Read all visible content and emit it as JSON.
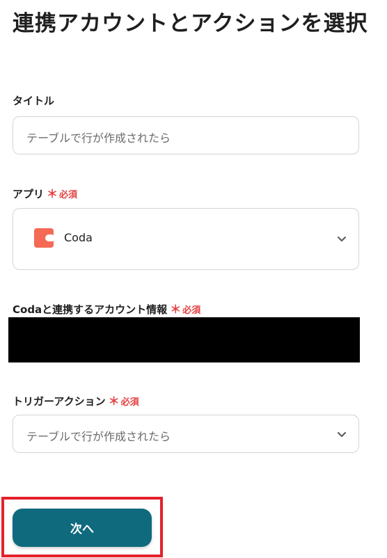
{
  "page": {
    "title": "連携アカウントとアクションを選択"
  },
  "form": {
    "title_field": {
      "label": "タイトル",
      "value": "テーブルで行が作成されたら"
    },
    "app_field": {
      "label": "アプリ",
      "required_star": "＊",
      "required_text": "必須",
      "selected": "Coda",
      "icon": "coda-logo",
      "icon_color": "#f46a54"
    },
    "account_field": {
      "label": "Codaと連携するアカウント情報",
      "required_star": "＊",
      "required_text": "必須"
    },
    "trigger_field": {
      "label": "トリガーアクション",
      "required_star": "＊",
      "required_text": "必須",
      "selected": "テーブルで行が作成されたら"
    }
  },
  "footer": {
    "next_label": "次へ",
    "accent_color": "#0f6a7e",
    "highlight_color": "#e3212b"
  }
}
